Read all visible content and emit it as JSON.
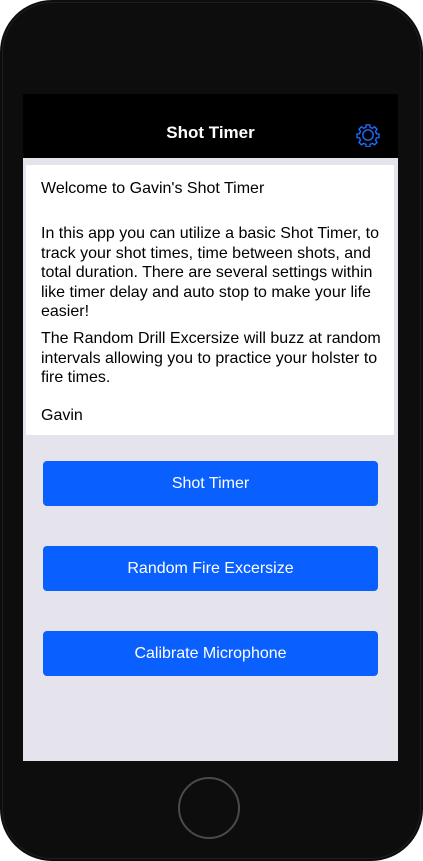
{
  "navbar": {
    "title": "Shot Timer",
    "settings_icon": "gear-icon",
    "background": "#000000",
    "icon_color": "#1a6dff"
  },
  "welcome": {
    "heading": "Welcome to Gavin's Shot Timer",
    "paragraph1": "In this app you can utilize a basic Shot Timer, to track your shot times, time between shots, and total duration. There are several settings within like timer delay and auto stop to make your life easier!",
    "paragraph2": "The Random Drill Excersize will buzz at random intervals allowing you to practice your holster to fire times.",
    "signature": "Gavin"
  },
  "buttons": {
    "shot_timer": "Shot Timer",
    "random_fire": "Random Fire Excersize",
    "calibrate": "Calibrate Microphone"
  },
  "colors": {
    "button_blue": "#0a5fff",
    "screen_background": "#e5e4ec",
    "device_body": "#0d0d0d"
  }
}
